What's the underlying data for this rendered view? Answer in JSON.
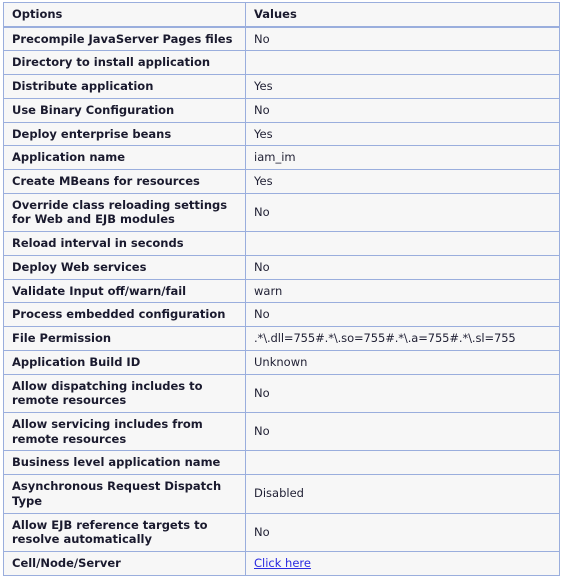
{
  "table": {
    "headers": {
      "options": "Options",
      "values": "Values"
    },
    "rows": [
      {
        "option": "Precompile JavaServer Pages files",
        "value": "No",
        "empty": false,
        "link": false
      },
      {
        "option": "Directory to install application",
        "value": "",
        "empty": true,
        "link": false
      },
      {
        "option": "Distribute application",
        "value": "Yes",
        "empty": false,
        "link": false
      },
      {
        "option": "Use Binary Configuration",
        "value": "No",
        "empty": false,
        "link": false
      },
      {
        "option": "Deploy enterprise beans",
        "value": "Yes",
        "empty": false,
        "link": false
      },
      {
        "option": "Application name",
        "value": "iam_im",
        "empty": false,
        "link": false
      },
      {
        "option": "Create MBeans for resources",
        "value": "Yes",
        "empty": false,
        "link": false
      },
      {
        "option": "Override class reloading settings for Web and EJB modules",
        "value": "No",
        "empty": false,
        "link": false
      },
      {
        "option": "Reload interval in seconds",
        "value": "",
        "empty": true,
        "link": false
      },
      {
        "option": "Deploy Web services",
        "value": "No",
        "empty": false,
        "link": false
      },
      {
        "option": "Validate Input off/warn/fail",
        "value": "warn",
        "empty": false,
        "link": false
      },
      {
        "option": "Process embedded configuration",
        "value": "No",
        "empty": false,
        "link": false
      },
      {
        "option": "File Permission",
        "value": ".*\\.dll=755#.*\\.so=755#.*\\.a=755#.*\\.sl=755",
        "empty": false,
        "link": false,
        "mono": true
      },
      {
        "option": "Application Build ID",
        "value": "Unknown",
        "empty": false,
        "link": false
      },
      {
        "option": "Allow dispatching includes to remote resources",
        "value": "No",
        "empty": false,
        "link": false
      },
      {
        "option": "Allow servicing includes from remote resources",
        "value": "No",
        "empty": false,
        "link": false
      },
      {
        "option": "Business level application name",
        "value": "",
        "empty": true,
        "link": false
      },
      {
        "option": "Asynchronous Request Dispatch Type",
        "value": "Disabled",
        "empty": false,
        "link": false
      },
      {
        "option": "Allow EJB reference targets to resolve automatically",
        "value": "No",
        "empty": false,
        "link": false
      },
      {
        "option": "Cell/Node/Server",
        "value": "Click here",
        "empty": false,
        "link": true
      }
    ]
  },
  "colors": {
    "header_background": "#ccd4e8",
    "border": "#9aaedd",
    "row_background": "#f7f7f7",
    "link": "#2a2ae0",
    "text": "#1a1a2e"
  }
}
